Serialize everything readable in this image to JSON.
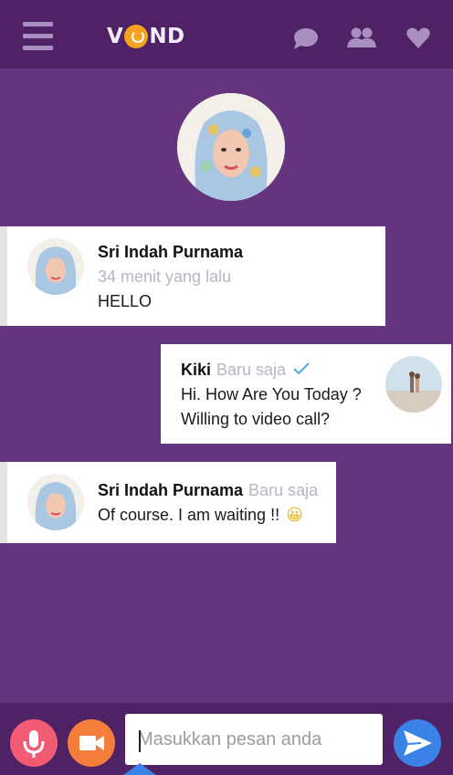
{
  "header": {
    "logo_text_left": "V",
    "logo_text_right": "ND",
    "icons": [
      "menu-icon",
      "chat-icon",
      "group-icon",
      "heart-icon"
    ]
  },
  "messages": [
    {
      "side": "left",
      "name": "Sri Indah Purnama",
      "time": "34 menit yang lalu",
      "text": "HELLO"
    },
    {
      "side": "right",
      "name": "Kiki",
      "time": "Baru saja",
      "text_lines": [
        "Hi. How Are You Today ?",
        "Willing to video call?"
      ],
      "status": "sent-check"
    },
    {
      "side": "left",
      "name": "Sri Indah Purnama",
      "time": "Baru saja",
      "text": "Of course. I am waiting !!",
      "emoji": "😀"
    }
  ],
  "composer": {
    "placeholder": "Masukkan pesan anda",
    "value": ""
  },
  "colors": {
    "background": "#65347f",
    "bars": "#4f2165",
    "mic": "#f15b74",
    "video": "#f57d3c",
    "send": "#3b82e6",
    "check": "#4aa8e8"
  }
}
